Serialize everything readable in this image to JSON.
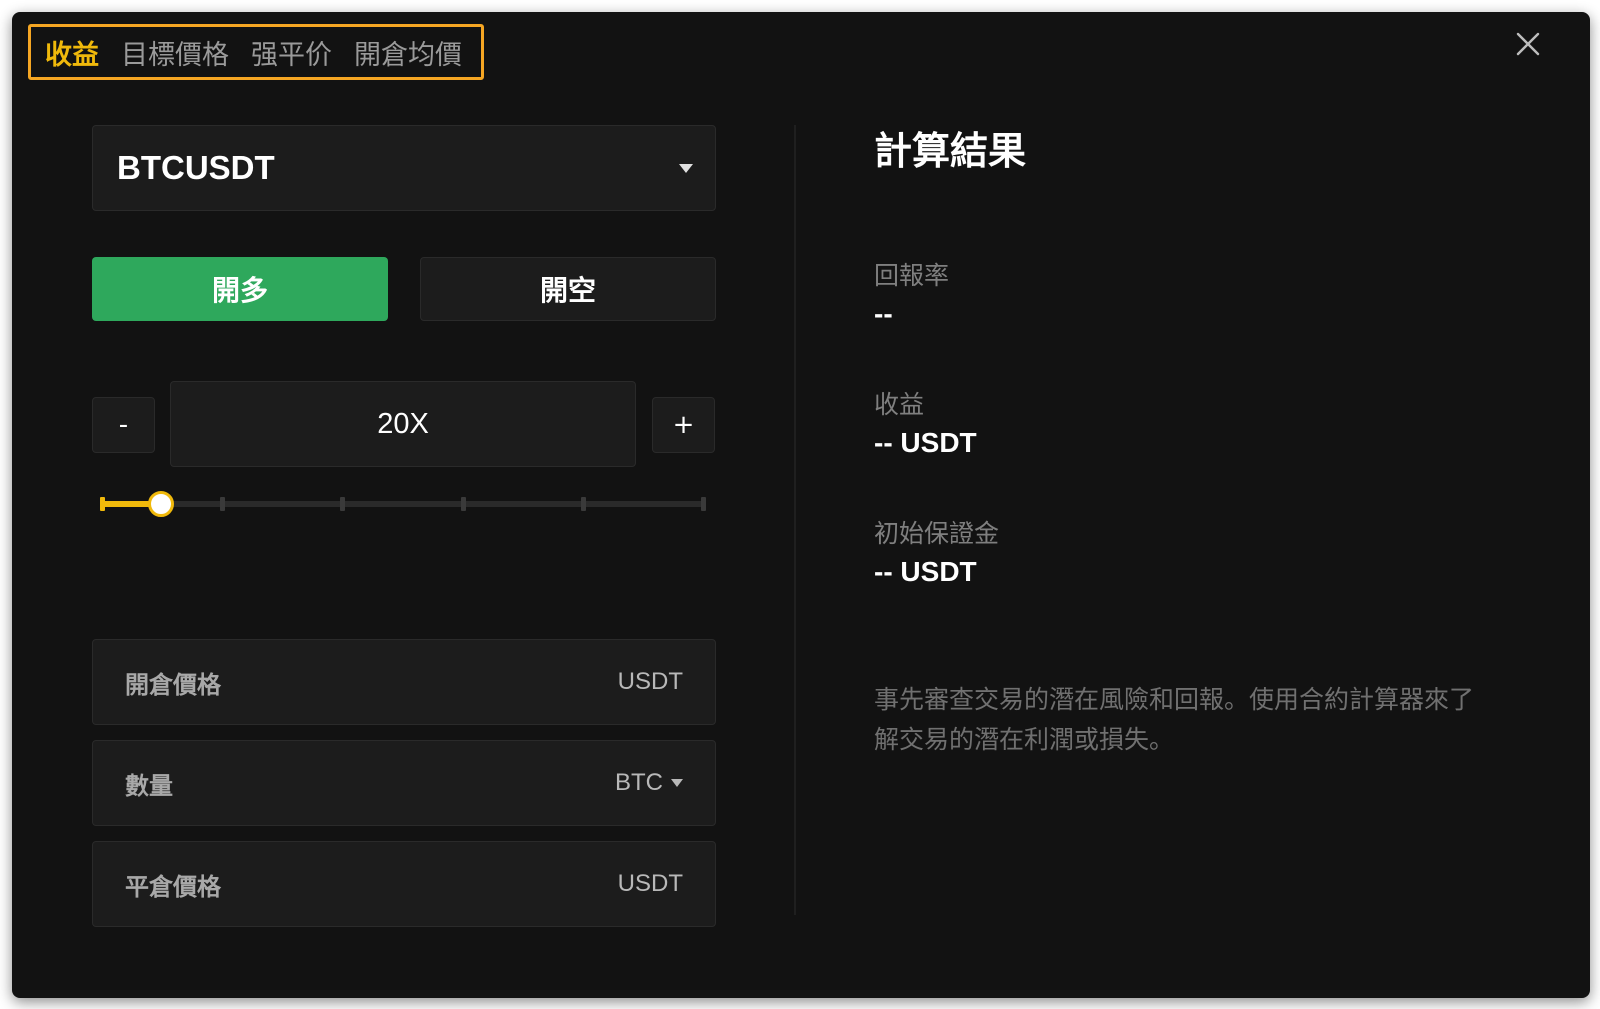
{
  "tabs": [
    {
      "label": "收益",
      "active": true
    },
    {
      "label": "目標價格",
      "active": false
    },
    {
      "label": "强平价",
      "active": false
    },
    {
      "label": "開倉均價",
      "active": false
    }
  ],
  "symbol": {
    "value": "BTCUSDT"
  },
  "sides": {
    "long_label": "開多",
    "short_label": "開空"
  },
  "leverage": {
    "minus_label": "-",
    "value": "20X",
    "plus_label": "+",
    "slider_fraction": 0.1
  },
  "fields": {
    "entry_price": {
      "label": "開倉價格",
      "unit": "USDT"
    },
    "quantity": {
      "label": "數量",
      "unit": "BTC"
    },
    "close_price": {
      "label": "平倉價格",
      "unit": "USDT"
    }
  },
  "results": {
    "title": "計算結果",
    "roi": {
      "label": "回報率",
      "value": "--"
    },
    "pnl": {
      "label": "收益",
      "value": "-- USDT"
    },
    "margin": {
      "label": "初始保證金",
      "value": "-- USDT"
    },
    "description": "事先審查交易的潛在風險和回報。使用合約計算器來了解交易的潛在利潤或損失。"
  },
  "colors": {
    "accent": "#f0b90b",
    "long": "#2ea85c",
    "background": "#121212"
  },
  "icons": {
    "close": "close-icon",
    "dropdown": "chevron-down-icon"
  }
}
